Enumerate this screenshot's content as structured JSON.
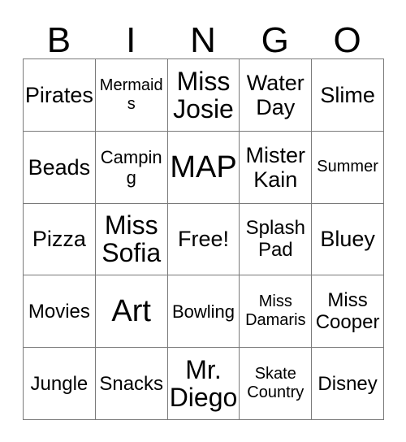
{
  "card": {
    "title": "BINGO",
    "header_letters": [
      "B",
      "I",
      "N",
      "G",
      "O"
    ],
    "border_color": "#7a7a7a",
    "text_color": "#000000",
    "background_color": "#ffffff",
    "rows": 5,
    "columns": 5,
    "free_space_label": "Free!",
    "cells": [
      [
        {
          "text": "Pirates",
          "size": "lg"
        },
        {
          "text": "Mermaids",
          "size": "xs"
        },
        {
          "text": "Miss Josie",
          "size": "xl"
        },
        {
          "text": "Water Day",
          "size": "lg"
        },
        {
          "text": "Slime",
          "size": "lg"
        }
      ],
      [
        {
          "text": "Beads",
          "size": "lg"
        },
        {
          "text": "Camping",
          "size": "sm"
        },
        {
          "text": "MAP",
          "size": "xxl"
        },
        {
          "text": "Mister Kain",
          "size": "lg"
        },
        {
          "text": "Summer",
          "size": "xs"
        }
      ],
      [
        {
          "text": "Pizza",
          "size": "lg"
        },
        {
          "text": "Miss Sofia",
          "size": "xl"
        },
        {
          "text": "Free!",
          "size": "lg"
        },
        {
          "text": "Splash Pad",
          "size": "md"
        },
        {
          "text": "Bluey",
          "size": "lg"
        }
      ],
      [
        {
          "text": "Movies",
          "size": "md"
        },
        {
          "text": "Art",
          "size": "xxl"
        },
        {
          "text": "Bowling",
          "size": "sm"
        },
        {
          "text": "Miss Damaris",
          "size": "xs"
        },
        {
          "text": "Miss Cooper",
          "size": "md"
        }
      ],
      [
        {
          "text": "Jungle",
          "size": "md"
        },
        {
          "text": "Snacks",
          "size": "md"
        },
        {
          "text": "Mr. Diego",
          "size": "xl"
        },
        {
          "text": "Skate Country",
          "size": "xs"
        },
        {
          "text": "Disney",
          "size": "md"
        }
      ]
    ]
  }
}
